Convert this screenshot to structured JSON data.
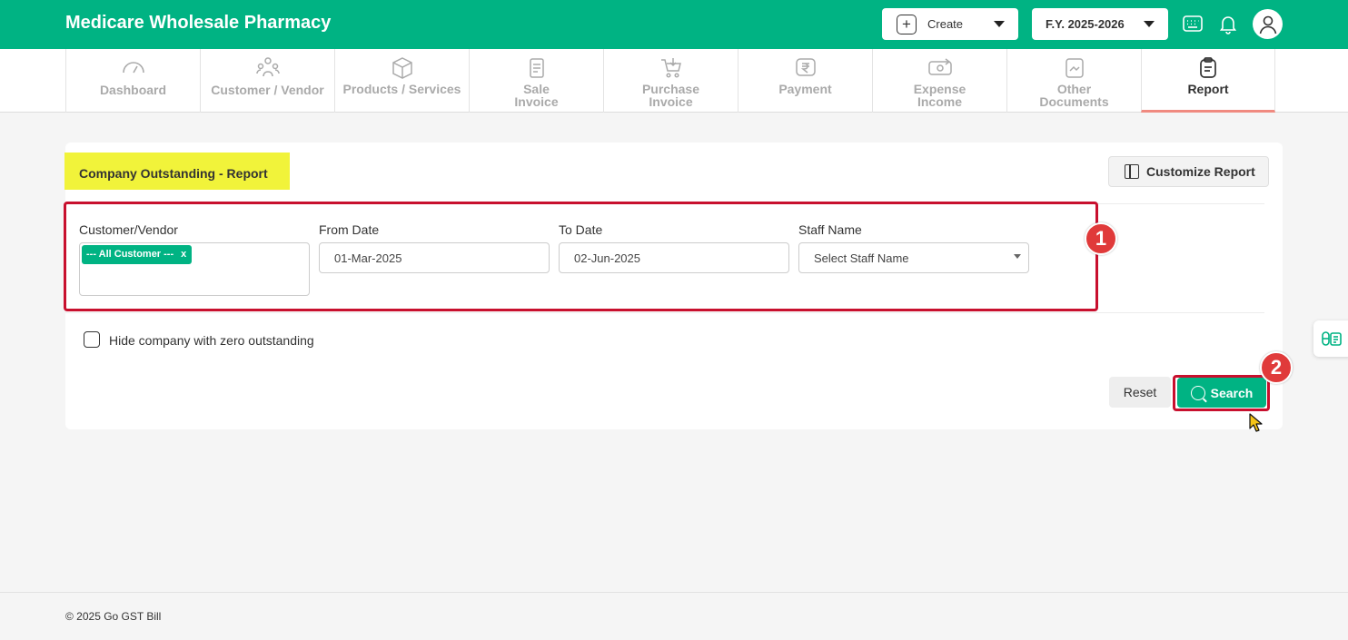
{
  "header": {
    "app_title": "Medicare Wholesale Pharmacy",
    "create_label": "Create",
    "fy_label": "F.Y. 2025-2026",
    "icons": [
      "keyboard-icon",
      "bell-icon",
      "user-avatar-icon"
    ],
    "brand_color": "#00b383"
  },
  "nav": {
    "tabs": [
      {
        "label": "Dashboard",
        "icon": "gauge-icon",
        "active": false
      },
      {
        "label": "Customer / Vendor",
        "icon": "people-icon",
        "active": false
      },
      {
        "label": "Products / Services",
        "icon": "box-icon",
        "active": false
      },
      {
        "label": "Sale Invoice",
        "line1": "Sale",
        "line2": "Invoice",
        "icon": "invoice-icon",
        "active": false
      },
      {
        "label": "Purchase Invoice",
        "line1": "Purchase",
        "line2": "Invoice",
        "icon": "cart-icon",
        "active": false
      },
      {
        "label": "Payment",
        "icon": "rupee-icon",
        "active": false
      },
      {
        "label": "Expense Income",
        "line1": "Expense",
        "line2": "Income",
        "icon": "money-exchange-icon",
        "active": false
      },
      {
        "label": "Other Documents",
        "line1": "Other",
        "line2": "Documents",
        "icon": "document-icon",
        "active": false
      },
      {
        "label": "Report",
        "icon": "clipboard-icon",
        "active": true
      }
    ]
  },
  "report": {
    "title": "Company Outstanding - Report",
    "customize_label": "Customize Report",
    "fields": {
      "customer_label": "Customer/Vendor",
      "customer_chip": "--- All Customer ---",
      "chip_remove": "x",
      "from_label": "From Date",
      "from_value": "01-Mar-2025",
      "to_label": "To Date",
      "to_value": "02-Jun-2025",
      "staff_label": "Staff Name",
      "staff_placeholder": "Select Staff Name"
    },
    "hide_zero_label": "Hide company with zero outstanding",
    "hide_zero_checked": false,
    "reset_label": "Reset",
    "search_label": "Search"
  },
  "annotations": {
    "step1": "1",
    "step2": "2",
    "color": "#c8102e"
  },
  "footer": {
    "copyright": "© 2025 Go GST Bill"
  }
}
